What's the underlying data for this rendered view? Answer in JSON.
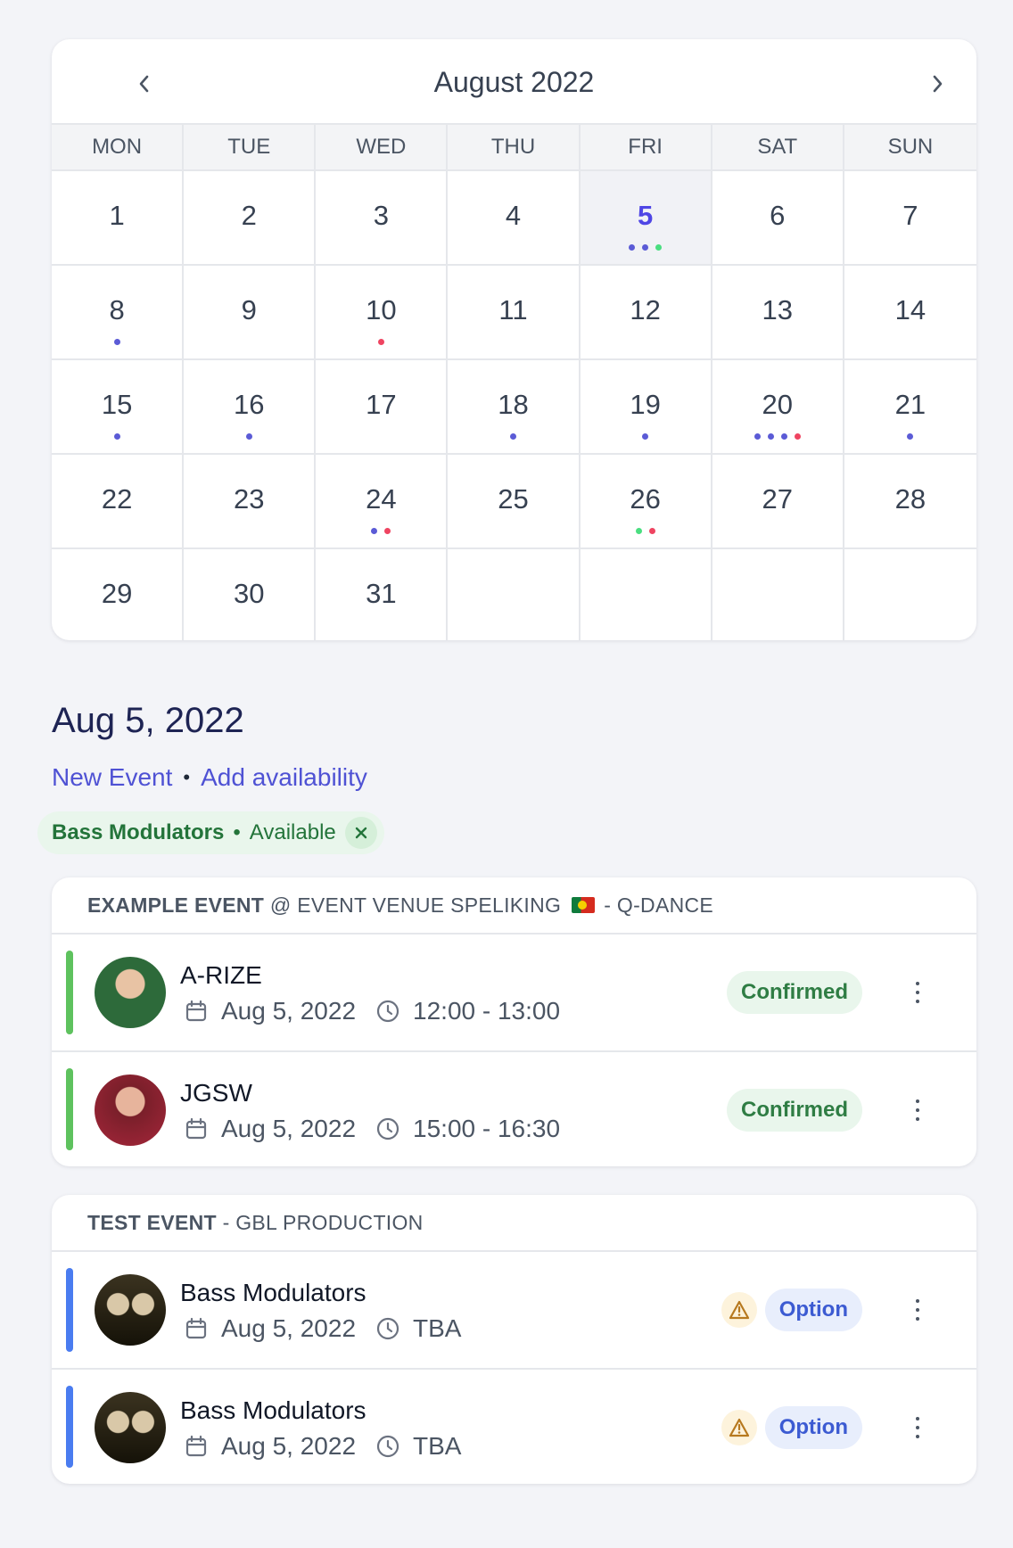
{
  "calendar": {
    "title": "August 2022",
    "weekdays": [
      "MON",
      "TUE",
      "WED",
      "THU",
      "FRI",
      "SAT",
      "SUN"
    ],
    "selected_day": 5,
    "days": [
      {
        "day": "1",
        "dots": []
      },
      {
        "day": "2",
        "dots": []
      },
      {
        "day": "3",
        "dots": []
      },
      {
        "day": "4",
        "dots": []
      },
      {
        "day": "5",
        "dots": [
          "blue",
          "blue",
          "green"
        ]
      },
      {
        "day": "6",
        "dots": []
      },
      {
        "day": "7",
        "dots": []
      },
      {
        "day": "8",
        "dots": [
          "blue"
        ]
      },
      {
        "day": "9",
        "dots": []
      },
      {
        "day": "10",
        "dots": [
          "red"
        ]
      },
      {
        "day": "11",
        "dots": []
      },
      {
        "day": "12",
        "dots": []
      },
      {
        "day": "13",
        "dots": []
      },
      {
        "day": "14",
        "dots": []
      },
      {
        "day": "15",
        "dots": [
          "blue"
        ]
      },
      {
        "day": "16",
        "dots": [
          "blue"
        ]
      },
      {
        "day": "17",
        "dots": []
      },
      {
        "day": "18",
        "dots": [
          "blue"
        ]
      },
      {
        "day": "19",
        "dots": [
          "blue"
        ]
      },
      {
        "day": "20",
        "dots": [
          "blue",
          "blue",
          "blue",
          "red"
        ]
      },
      {
        "day": "21",
        "dots": [
          "blue"
        ]
      },
      {
        "day": "22",
        "dots": []
      },
      {
        "day": "23",
        "dots": []
      },
      {
        "day": "24",
        "dots": [
          "blue",
          "red"
        ]
      },
      {
        "day": "25",
        "dots": []
      },
      {
        "day": "26",
        "dots": [
          "green",
          "red"
        ]
      },
      {
        "day": "27",
        "dots": []
      },
      {
        "day": "28",
        "dots": []
      },
      {
        "day": "29",
        "dots": []
      },
      {
        "day": "30",
        "dots": []
      },
      {
        "day": "31",
        "dots": []
      },
      {
        "day": "",
        "dots": []
      },
      {
        "day": "",
        "dots": []
      },
      {
        "day": "",
        "dots": []
      },
      {
        "day": "",
        "dots": []
      }
    ]
  },
  "selected_date": "Aug 5, 2022",
  "actions": {
    "new_event": "New Event",
    "separator": "•",
    "add_availability": "Add availability"
  },
  "availability": {
    "name": "Bass Modulators",
    "separator": "•",
    "status": "Available"
  },
  "events": [
    {
      "name": "EXAMPLE EVENT",
      "venue": "@ EVENT VENUE SPELIKING",
      "flag": "portugal-flag",
      "org": "- Q-DANCE",
      "bookings": [
        {
          "artist": "A-RIZE",
          "date": "Aug 5, 2022",
          "time": "12:00 - 13:00",
          "status": "Confirmed",
          "status_type": "confirmed",
          "warning": false,
          "avatar": "av-green"
        },
        {
          "artist": "JGSW",
          "date": "Aug 5, 2022",
          "time": "15:00 - 16:30",
          "status": "Confirmed",
          "status_type": "confirmed",
          "warning": false,
          "avatar": "av-red"
        }
      ]
    },
    {
      "name": "TEST EVENT",
      "venue": "",
      "flag": "",
      "org": "- GBL PRODUCTION",
      "bookings": [
        {
          "artist": "Bass Modulators",
          "date": "Aug 5, 2022",
          "time": "TBA",
          "status": "Option",
          "status_type": "option",
          "warning": true,
          "avatar": "av-duo"
        },
        {
          "artist": "Bass Modulators",
          "date": "Aug 5, 2022",
          "time": "TBA",
          "status": "Option",
          "status_type": "option",
          "warning": true,
          "avatar": "av-duo"
        }
      ]
    }
  ],
  "colors": {
    "accent": "#4f46e5",
    "confirmed": "#2f7d44",
    "option": "#3c5bd2",
    "dot_blue": "#5b5bd6",
    "dot_red": "#ef4461",
    "dot_green": "#4ade80"
  }
}
